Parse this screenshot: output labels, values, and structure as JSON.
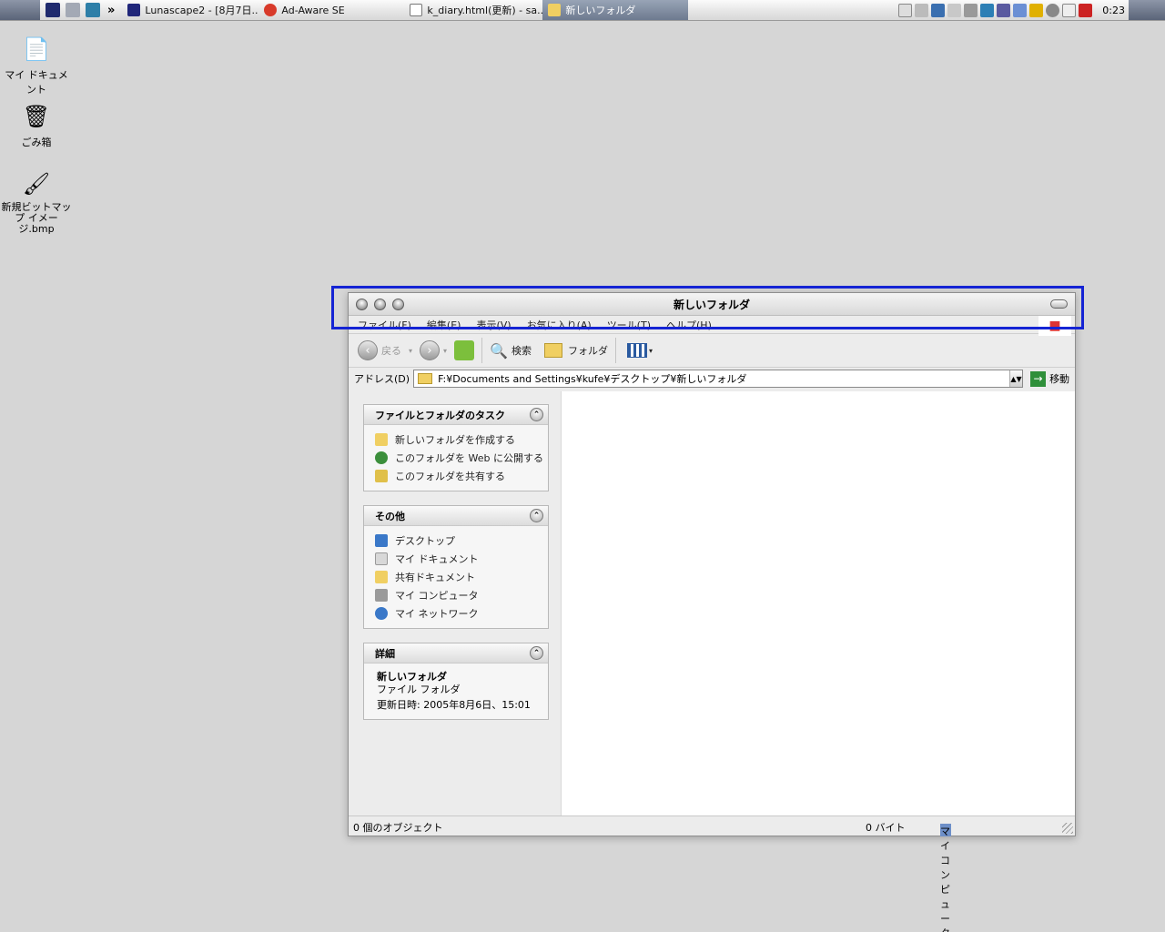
{
  "taskbar": {
    "overflow_glyph": "»",
    "tasks": [
      {
        "label": "Lunascape2 - [8月7日..."
      },
      {
        "label": "Ad-Aware SE"
      },
      {
        "label": "k_diary.html(更新) - sa..."
      },
      {
        "label": "新しいフォルダ"
      }
    ],
    "clock": "0:23"
  },
  "desktop": {
    "icons": [
      {
        "label": "マイ ドキュメント",
        "icon": "my-documents-icon"
      },
      {
        "label": "ごみ箱",
        "icon": "recycle-bin-icon"
      },
      {
        "label": "新規ビットマップ イメージ.bmp",
        "icon": "bitmap-file-icon"
      }
    ]
  },
  "window": {
    "title": "新しいフォルダ",
    "menu": [
      "ファイル(F)",
      "編集(E)",
      "表示(V)",
      "お気に入り(A)",
      "ツール(T)",
      "ヘルプ(H)"
    ],
    "toolbar": {
      "back": "戻る",
      "search": "検索",
      "folders": "フォルダ"
    },
    "address": {
      "label": "アドレス(D)",
      "value": "F:¥Documents and Settings¥kufe¥デスクトップ¥新しいフォルダ",
      "go": "移動"
    },
    "tasks_panel": {
      "title": "ファイルとフォルダのタスク",
      "items": [
        "新しいフォルダを作成する",
        "このフォルダを Web に公開する",
        "このフォルダを共有する"
      ]
    },
    "other_panel": {
      "title": "その他",
      "items": [
        "デスクトップ",
        "マイ ドキュメント",
        "共有ドキュメント",
        "マイ コンピュータ",
        "マイ ネットワーク"
      ]
    },
    "details_panel": {
      "title": "詳細",
      "name": "新しいフォルダ",
      "type": "ファイル フォルダ",
      "modified": "更新日時: 2005年8月6日、15:01"
    },
    "status": {
      "objects": "0 個のオブジェクト",
      "size": "0 バイト",
      "location": "マイ コンピュータ"
    }
  },
  "colors": {
    "highlight_box": "#1524d4",
    "desktop_bg": "#d6d6d6"
  }
}
